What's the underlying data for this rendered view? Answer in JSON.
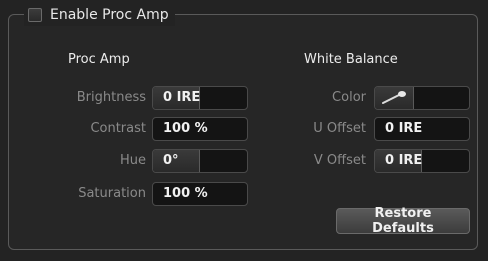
{
  "enable": {
    "label": "Enable Proc Amp",
    "checked": false
  },
  "proc_amp": {
    "title": "Proc Amp",
    "rows": [
      {
        "label": "Brightness",
        "value": "0 IRE",
        "level": 0.48
      },
      {
        "label": "Contrast",
        "value": "100 %",
        "level": 0.0
      },
      {
        "label": "Hue",
        "value": "0°",
        "level": 0.48
      },
      {
        "label": "Saturation",
        "value": "100 %",
        "level": 0.0
      }
    ]
  },
  "white_balance": {
    "title": "White Balance",
    "color_label": "Color",
    "rows": [
      {
        "label": "U Offset",
        "value": "0 IRE"
      },
      {
        "label": "V Offset",
        "value": "0 IRE",
        "level": 0.48
      }
    ]
  },
  "restore_label": "Restore Defaults"
}
